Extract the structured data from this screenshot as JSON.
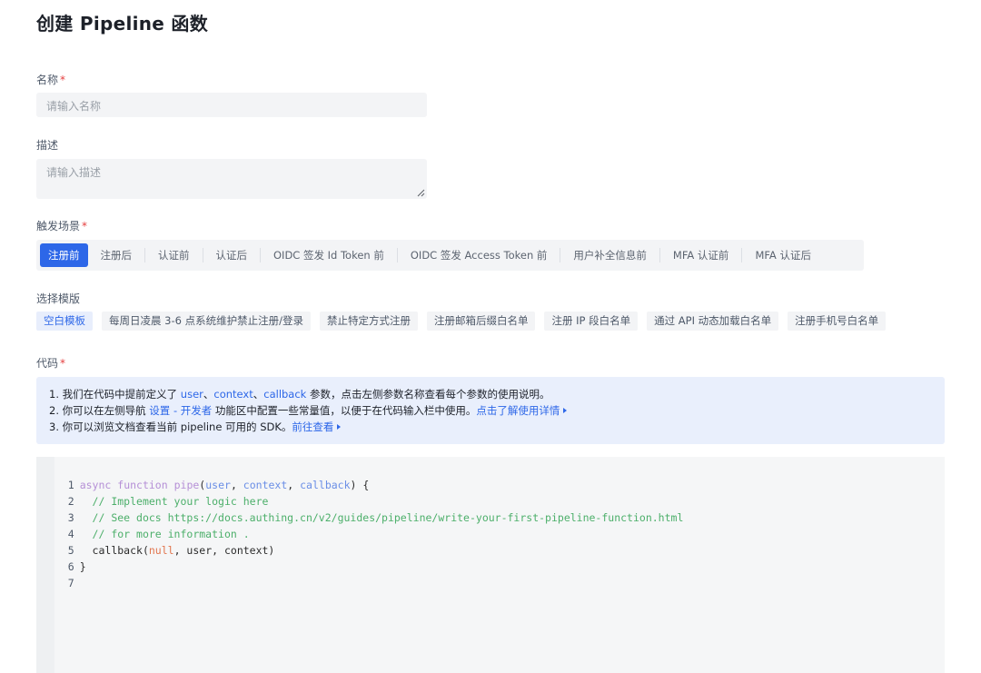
{
  "page": {
    "title": "创建 Pipeline 函数"
  },
  "form": {
    "name_label": "名称",
    "name_placeholder": "请输入名称",
    "desc_label": "描述",
    "desc_placeholder": "请输入描述",
    "trigger_label": "触发场景",
    "template_label": "选择模版",
    "code_label": "代码",
    "required_mark": "*"
  },
  "trigger_tabs": [
    "注册前",
    "注册后",
    "认证前",
    "认证后",
    "OIDC 签发 Id Token 前",
    "OIDC 签发 Access Token 前",
    "用户补全信息前",
    "MFA 认证前",
    "MFA 认证后"
  ],
  "templates": [
    "空白模板",
    "每周日凌晨 3-6 点系统维护禁止注册/登录",
    "禁止特定方式注册",
    "注册邮箱后缀白名单",
    "注册 IP 段白名单",
    "通过 API 动态加载白名单",
    "注册手机号白名单"
  ],
  "info": {
    "line1_a": "1. 我们在代码中提前定义了 ",
    "line1_user": "user",
    "line1_sep1": "、",
    "line1_context": "context",
    "line1_sep2": "、",
    "line1_callback": "callback",
    "line1_b": " 参数，点击左侧参数名称查看每个参数的使用说明。",
    "line2_a": "2. 你可以在左侧导航 ",
    "line2_link": "设置 - 开发者",
    "line2_b": " 功能区中配置一些常量值，以便于在代码输入栏中使用。",
    "line2_link2": "点击了解使用详情",
    "line3_a": "3. 你可以浏览文档查看当前 pipeline 可用的 SDK。",
    "line3_link": "前往查看"
  },
  "code": {
    "line_numbers": [
      "1",
      "2",
      "3",
      "4",
      "5",
      "6",
      "7"
    ],
    "l1_async": "async",
    "l1_function": "function",
    "l1_pipe": "pipe",
    "l1_open": "(",
    "l1_user": "user",
    "l1_comma1": ", ",
    "l1_context": "context",
    "l1_comma2": ", ",
    "l1_callback": "callback",
    "l1_close": ") {",
    "l2": "  // Implement your logic here",
    "l3": "  // See docs https://docs.authing.cn/v2/guides/pipeline/write-your-first-pipeline-function.html",
    "l4": "  // for more information .",
    "l5_a": "  callback(",
    "l5_null": "null",
    "l5_b": ", user, context)",
    "l6": "}"
  }
}
